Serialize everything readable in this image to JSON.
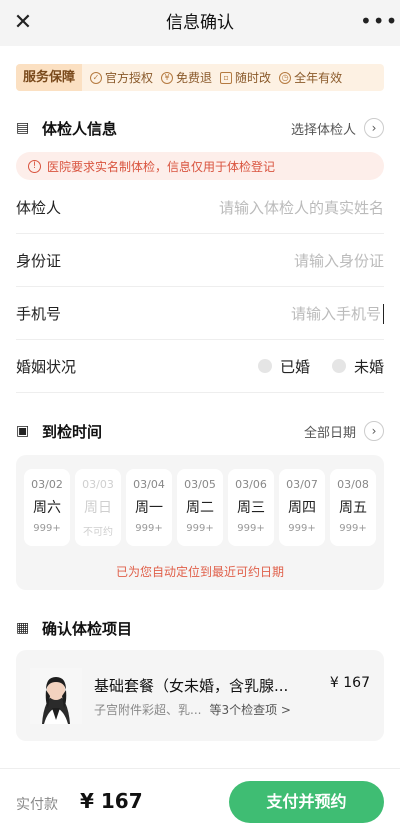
{
  "header": {
    "title": "信息确认",
    "close_icon": "close-icon",
    "more_icon": "more-icon"
  },
  "service": {
    "badge": "服务保障",
    "items": [
      {
        "label": "官方授权",
        "icon": "shield-check-icon"
      },
      {
        "label": "免费退",
        "icon": "refund-icon"
      },
      {
        "label": "随时改",
        "icon": "calendar-icon"
      },
      {
        "label": "全年有效",
        "icon": "clock-icon"
      }
    ]
  },
  "examinee": {
    "title": "体检人信息",
    "select_label": "选择体检人",
    "notice": "医院要求实名制体检，信息仅用于体检登记",
    "name_label": "体检人",
    "name_placeholder": "请输入体检人的真实姓名",
    "id_label": "身份证",
    "id_placeholder": "请输入身份证",
    "phone_label": "手机号",
    "phone_placeholder": "请输入手机号",
    "marital_label": "婚姻状况",
    "marital_options": [
      "已婚",
      "未婚"
    ]
  },
  "schedule": {
    "title": "到检时间",
    "all_dates_label": "全部日期",
    "dates": [
      {
        "date": "03/02",
        "weekday": "周六",
        "count": "999+",
        "disabled": false
      },
      {
        "date": "03/03",
        "weekday": "周日",
        "count": "不可约",
        "disabled": true
      },
      {
        "date": "03/04",
        "weekday": "周一",
        "count": "999+",
        "disabled": false
      },
      {
        "date": "03/05",
        "weekday": "周二",
        "count": "999+",
        "disabled": false
      },
      {
        "date": "03/06",
        "weekday": "周三",
        "count": "999+",
        "disabled": false
      },
      {
        "date": "03/07",
        "weekday": "周四",
        "count": "999+",
        "disabled": false
      },
      {
        "date": "03/08",
        "weekday": "周五",
        "count": "999+",
        "disabled": false
      }
    ],
    "hint": "已为您自动定位到最近可约日期"
  },
  "items": {
    "title": "确认体检项目",
    "package_name": "基础套餐（女未婚，含乳腺...",
    "package_price": "¥ 167",
    "package_desc": "子宫附件彩超、乳...",
    "package_more": "等3个检查项 >"
  },
  "footer": {
    "paid_label": "实付款",
    "amount": "¥ 167",
    "pay_button": "支付并预约"
  },
  "colors": {
    "accent": "#3fbd73",
    "warning": "#d9543f",
    "service_bg": "#fdf1e3"
  }
}
